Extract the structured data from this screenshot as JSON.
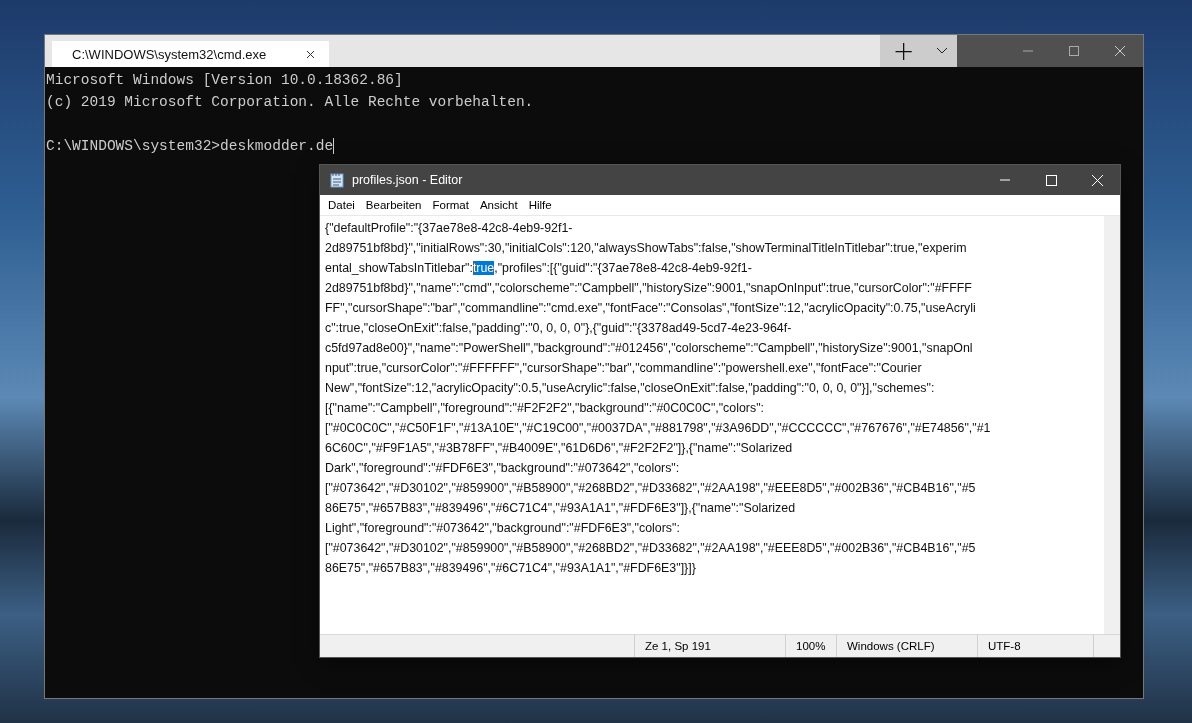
{
  "terminal": {
    "tab": {
      "title": "C:\\WINDOWS\\system32\\cmd.exe",
      "selected": true
    },
    "new_tab_button": "+",
    "lines": [
      "Microsoft Windows [Version 10.0.18362.86]",
      "(c) 2019 Microsoft Corporation. Alle Rechte vorbehalten."
    ],
    "prompt": "C:\\WINDOWS\\system32>deskmodder.de"
  },
  "editor": {
    "title": "profiles.json - Editor",
    "menu": [
      "Datei",
      "Bearbeiten",
      "Format",
      "Ansicht",
      "Hilfe"
    ],
    "lines": [
      [
        {
          "text": "{\"defaultProfile\":\"{37ae78e8-42c8-4eb9-92f1-",
          "selected": false
        }
      ],
      [
        {
          "text": "2d89751bf8bd}\",\"initialRows\":30,\"initialCols\":120,\"alwaysShowTabs\":false,\"showTerminalTitleInTitlebar\":true,\"experim",
          "selected": false
        }
      ],
      [
        {
          "text": "ental_showTabsInTitlebar\":",
          "selected": false
        },
        {
          "text": "true",
          "selected": true
        },
        {
          "text": ",\"profiles\":[{\"guid\":\"{37ae78e8-42c8-4eb9-92f1-",
          "selected": false
        }
      ],
      [
        {
          "text": "2d89751bf8bd}\",\"name\":\"cmd\",\"colorscheme\":\"Campbell\",\"historySize\":9001,\"snapOnInput\":true,\"cursorColor\":\"#FFFF",
          "selected": false
        }
      ],
      [
        {
          "text": "FF\",\"cursorShape\":\"bar\",\"commandline\":\"cmd.exe\",\"fontFace\":\"Consolas\",\"fontSize\":12,\"acrylicOpacity\":0.75,\"useAcryli",
          "selected": false
        }
      ],
      [
        {
          "text": "c\":true,\"closeOnExit\":false,\"padding\":\"0, 0, 0, 0\"},{\"guid\":\"{3378ad49-5cd7-4e23-964f-",
          "selected": false
        }
      ],
      [
        {
          "text": "c5fd97ad8e00}\",\"name\":\"PowerShell\",\"background\":\"#012456\",\"colorscheme\":\"Campbell\",\"historySize\":9001,\"snapOnl",
          "selected": false
        }
      ],
      [
        {
          "text": "nput\":true,\"cursorColor\":\"#FFFFFF\",\"cursorShape\":\"bar\",\"commandline\":\"powershell.exe\",\"fontFace\":\"Courier",
          "selected": false
        }
      ],
      [
        {
          "text": "New\",\"fontSize\":12,\"acrylicOpacity\":0.5,\"useAcrylic\":false,\"closeOnExit\":false,\"padding\":\"0, 0, 0, 0\"}],\"schemes\":",
          "selected": false
        }
      ],
      [
        {
          "text": "[{\"name\":\"Campbell\",\"foreground\":\"#F2F2F2\",\"background\":\"#0C0C0C\",\"colors\":",
          "selected": false
        }
      ],
      [
        {
          "text": "[\"#0C0C0C\",\"#C50F1F\",\"#13A10E\",\"#C19C00\",\"#0037DA\",\"#881798\",\"#3A96DD\",\"#CCCCCC\",\"#767676\",\"#E74856\",\"#1",
          "selected": false
        }
      ],
      [
        {
          "text": "6C60C\",\"#F9F1A5\",\"#3B78FF\",\"#B4009E\",\"61D6D6\",\"#F2F2F2\"]},{\"name\":\"Solarized",
          "selected": false
        }
      ],
      [
        {
          "text": "Dark\",\"foreground\":\"#FDF6E3\",\"background\":\"#073642\",\"colors\":",
          "selected": false
        }
      ],
      [
        {
          "text": "[\"#073642\",\"#D30102\",\"#859900\",\"#B58900\",\"#268BD2\",\"#D33682\",\"#2AA198\",\"#EEE8D5\",\"#002B36\",\"#CB4B16\",\"#5",
          "selected": false
        }
      ],
      [
        {
          "text": "86E75\",\"#657B83\",\"#839496\",\"#6C71C4\",\"#93A1A1\",\"#FDF6E3\"]},{\"name\":\"Solarized",
          "selected": false
        }
      ],
      [
        {
          "text": "Light\",\"foreground\":\"#073642\",\"background\":\"#FDF6E3\",\"colors\":",
          "selected": false
        }
      ],
      [
        {
          "text": "[\"#073642\",\"#D30102\",\"#859900\",\"#B58900\",\"#268BD2\",\"#D33682\",\"#2AA198\",\"#EEE8D5\",\"#002B36\",\"#CB4B16\",\"#5",
          "selected": false
        }
      ],
      [
        {
          "text": "86E75\",\"#657B83\",\"#839496\",\"#6C71C4\",\"#93A1A1\",\"#FDF6E3\"]}]}",
          "selected": false
        }
      ]
    ],
    "status_bar": [
      "Ze 1, Sp 191",
      "100%",
      "Windows (CRLF)",
      "UTF-8"
    ]
  }
}
